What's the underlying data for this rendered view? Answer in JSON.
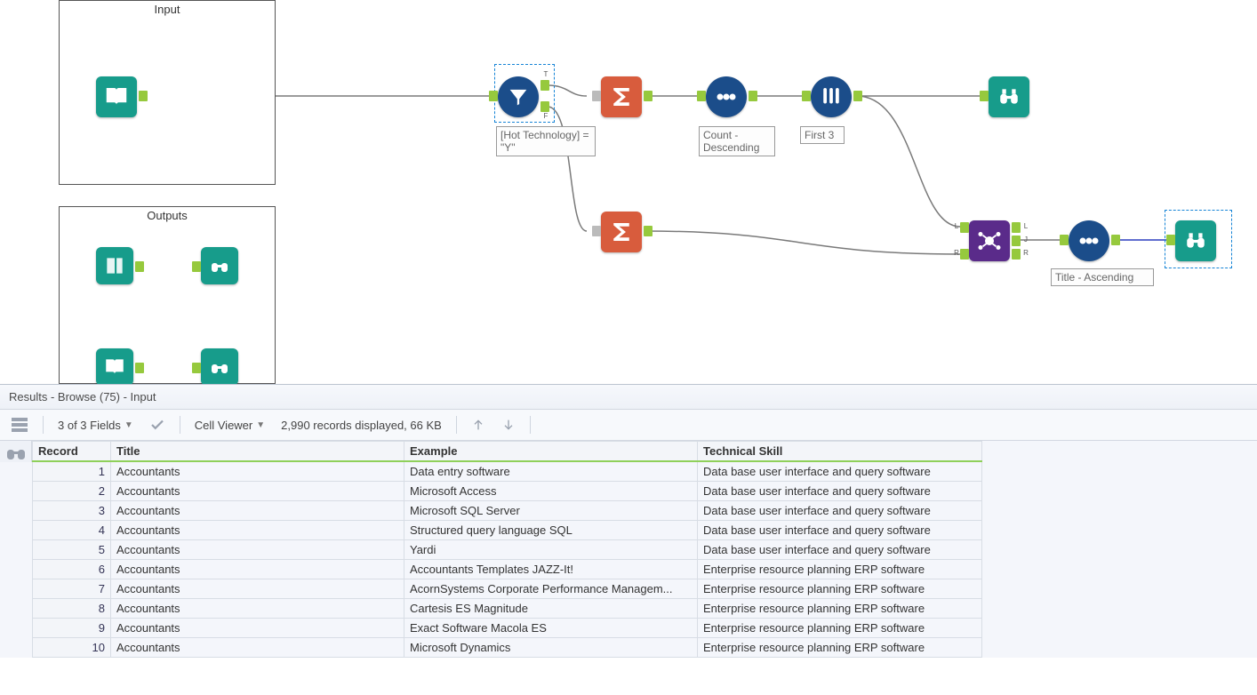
{
  "canvas": {
    "containers": {
      "input_title": "Input",
      "outputs_title": "Outputs"
    },
    "node_labels": {
      "filter": "[Hot Technology] = \"Y\"",
      "sort_count": "Count - Descending",
      "sample": "First 3",
      "sort_title": "Title - Ascending"
    },
    "join_anchors": {
      "L": "L",
      "J": "J",
      "R": "R"
    },
    "filter_anchors": {
      "T": "T",
      "F": "F"
    }
  },
  "results": {
    "header": "Results - Browse (75) - Input",
    "fields_text": "3 of 3 Fields",
    "cell_viewer": "Cell Viewer",
    "records_text": "2,990 records displayed, 66 KB",
    "columns": {
      "record": "Record",
      "title": "Title",
      "example": "Example",
      "skill": "Technical Skill"
    },
    "rows": [
      {
        "n": "1",
        "title": "Accountants",
        "example": "Data entry software",
        "skill": "Data base user interface and query software"
      },
      {
        "n": "2",
        "title": "Accountants",
        "example": "Microsoft Access",
        "skill": "Data base user interface and query software"
      },
      {
        "n": "3",
        "title": "Accountants",
        "example": "Microsoft SQL Server",
        "skill": "Data base user interface and query software"
      },
      {
        "n": "4",
        "title": "Accountants",
        "example": "Structured query language SQL",
        "skill": "Data base user interface and query software"
      },
      {
        "n": "5",
        "title": "Accountants",
        "example": "Yardi",
        "skill": "Data base user interface and query software"
      },
      {
        "n": "6",
        "title": "Accountants",
        "example": "Accountants Templates JAZZ-It!",
        "skill": "Enterprise resource planning ERP software"
      },
      {
        "n": "7",
        "title": "Accountants",
        "example": "AcornSystems Corporate Performance Managem...",
        "skill": "Enterprise resource planning ERP software"
      },
      {
        "n": "8",
        "title": "Accountants",
        "example": "Cartesis ES Magnitude",
        "skill": "Enterprise resource planning ERP software"
      },
      {
        "n": "9",
        "title": "Accountants",
        "example": "Exact Software Macola ES",
        "skill": "Enterprise resource planning ERP software"
      },
      {
        "n": "10",
        "title": "Accountants",
        "example": "Microsoft Dynamics",
        "skill": "Enterprise resource planning ERP software"
      }
    ]
  }
}
